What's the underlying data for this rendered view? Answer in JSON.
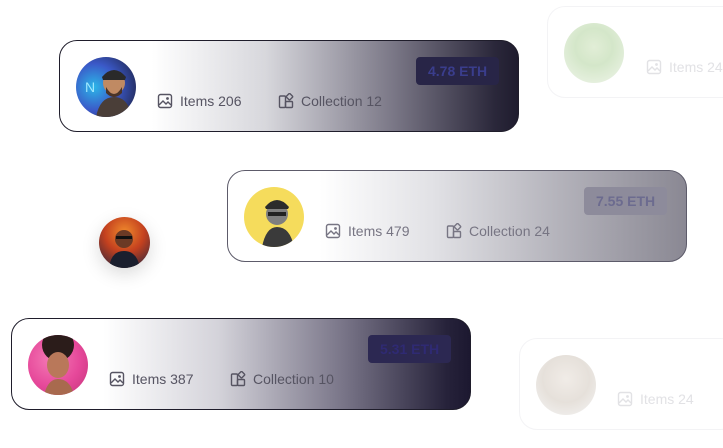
{
  "cards": [
    {
      "items_label": "Items 206",
      "collection_label": "Collection 12",
      "price": "4.78 ETH"
    },
    {
      "items_label": "Items 479",
      "collection_label": "Collection 24",
      "price": "7.55 ETH"
    },
    {
      "items_label": "Items 387",
      "collection_label": "Collection 10",
      "price": "5.31 ETH"
    },
    {
      "items_label": "Items 24"
    },
    {
      "items_label": "Items 24"
    }
  ],
  "icons": {
    "items": "image-icon",
    "collection": "collection-icon"
  },
  "colors": {
    "dark": "#1f1c2e",
    "text": "#565462",
    "price_bg": "#282547",
    "price_text": "#3a3d8c"
  }
}
